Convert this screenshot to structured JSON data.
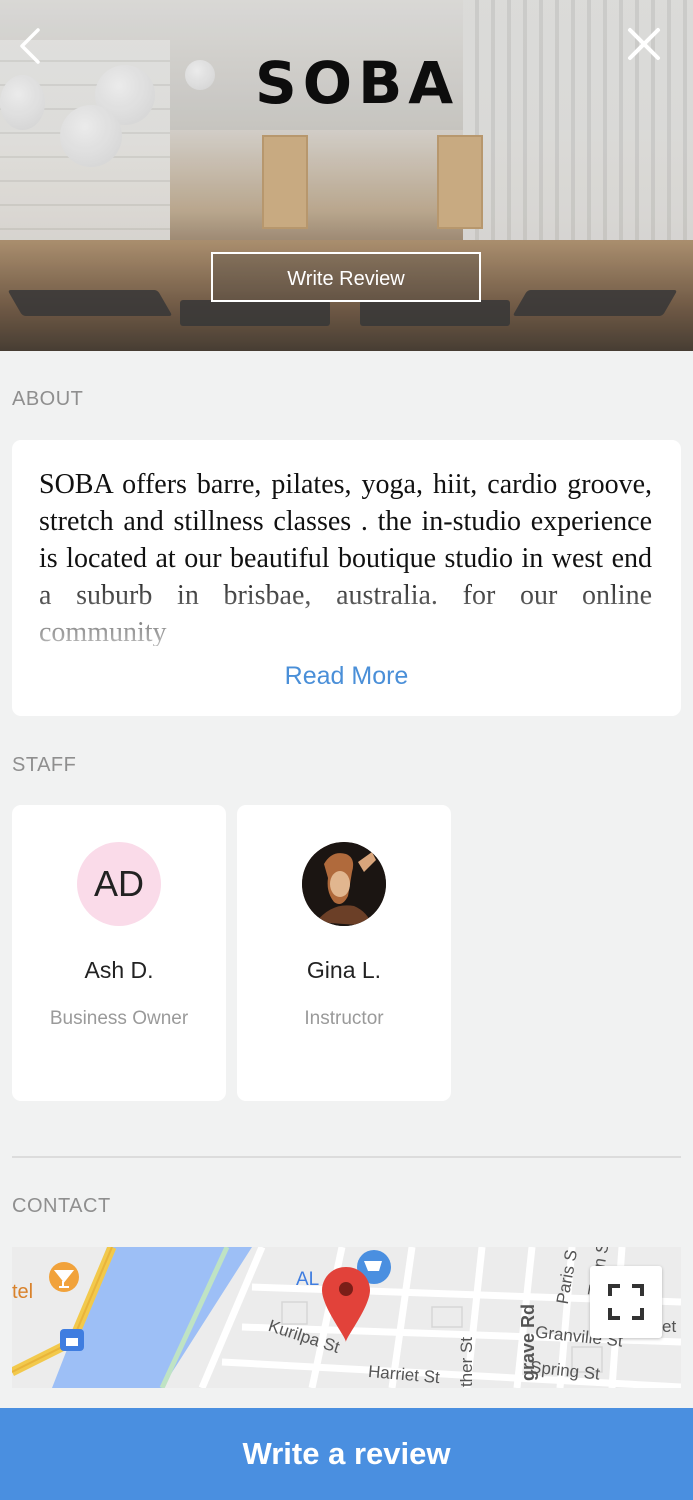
{
  "header": {
    "logo_text": "SOBA",
    "write_review_label": "Write Review",
    "back_icon": "chevron-left-icon",
    "close_icon": "close-icon"
  },
  "about": {
    "section_label": "ABOUT",
    "text": "SOBA offers barre, pilates, yoga, hiit, cardio groove, stretch and stillness classes . the in-studio experience is located at our beautiful boutique studio in west end a suburb in brisbae, australia. for our online community",
    "read_more_label": "Read More"
  },
  "staff": {
    "section_label": "STAFF",
    "members": [
      {
        "initials": "AD",
        "name": "Ash D.",
        "role": "Business Owner"
      },
      {
        "initials": "",
        "name": "Gina L.",
        "role": "Instructor"
      }
    ]
  },
  "contact": {
    "section_label": "CONTACT",
    "map_labels": {
      "hotel": "tel",
      "aldi": "AL",
      "kurilpa": "Kurilpa St",
      "harriet": "Harriet St",
      "other": "ther St",
      "grave": "grave Rd",
      "paris": "Paris S",
      "turin": "Turin S",
      "granville": "Granville St",
      "spring": "Spring St",
      "et": "et"
    }
  },
  "footer": {
    "write_a_review_label": "Write a review"
  },
  "colors": {
    "accent": "#4a8fe0",
    "link": "#4a8fd8",
    "background": "#f1f2f2",
    "avatar_initials_bg": "#fadbe9"
  }
}
